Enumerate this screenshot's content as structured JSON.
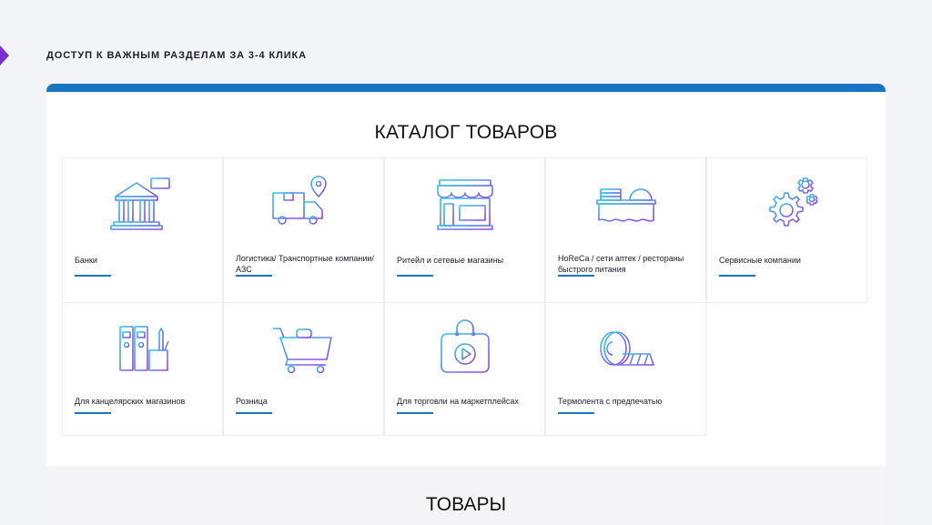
{
  "section_title": "ДОСТУП К ВАЖНЫМ РАЗДЕЛАМ ЗА 3-4 КЛИКА",
  "catalog": {
    "title": "КАТАЛОГ ТОВАРОВ",
    "items": [
      {
        "label": "Банки",
        "icon": "bank-icon"
      },
      {
        "label": "Логистика/ Транспортные компании/ АЗС",
        "icon": "delivery-truck-icon"
      },
      {
        "label": "Ритейл и сетевые магазины",
        "icon": "storefront-icon"
      },
      {
        "label": "HoReCa / сети аптек / рестораны быстрого питания",
        "icon": "restaurant-counter-icon"
      },
      {
        "label": "Сервисные компании",
        "icon": "gears-icon"
      },
      {
        "label": "Для канцелярских магазинов",
        "icon": "office-binders-icon"
      },
      {
        "label": "Розница",
        "icon": "shopping-cart-icon"
      },
      {
        "label": "Для торговли на маркетплейсах",
        "icon": "shopping-bag-play-icon"
      },
      {
        "label": "Термолента с предпечатью",
        "icon": "thermal-tape-roll-icon"
      }
    ]
  },
  "goods": {
    "title": "ТОВАРЫ"
  },
  "colors": {
    "accent": "#1a74c4",
    "gradient_start": "#2cc9ec",
    "gradient_end": "#9b3fe6",
    "marker": "#7a2fd0"
  }
}
